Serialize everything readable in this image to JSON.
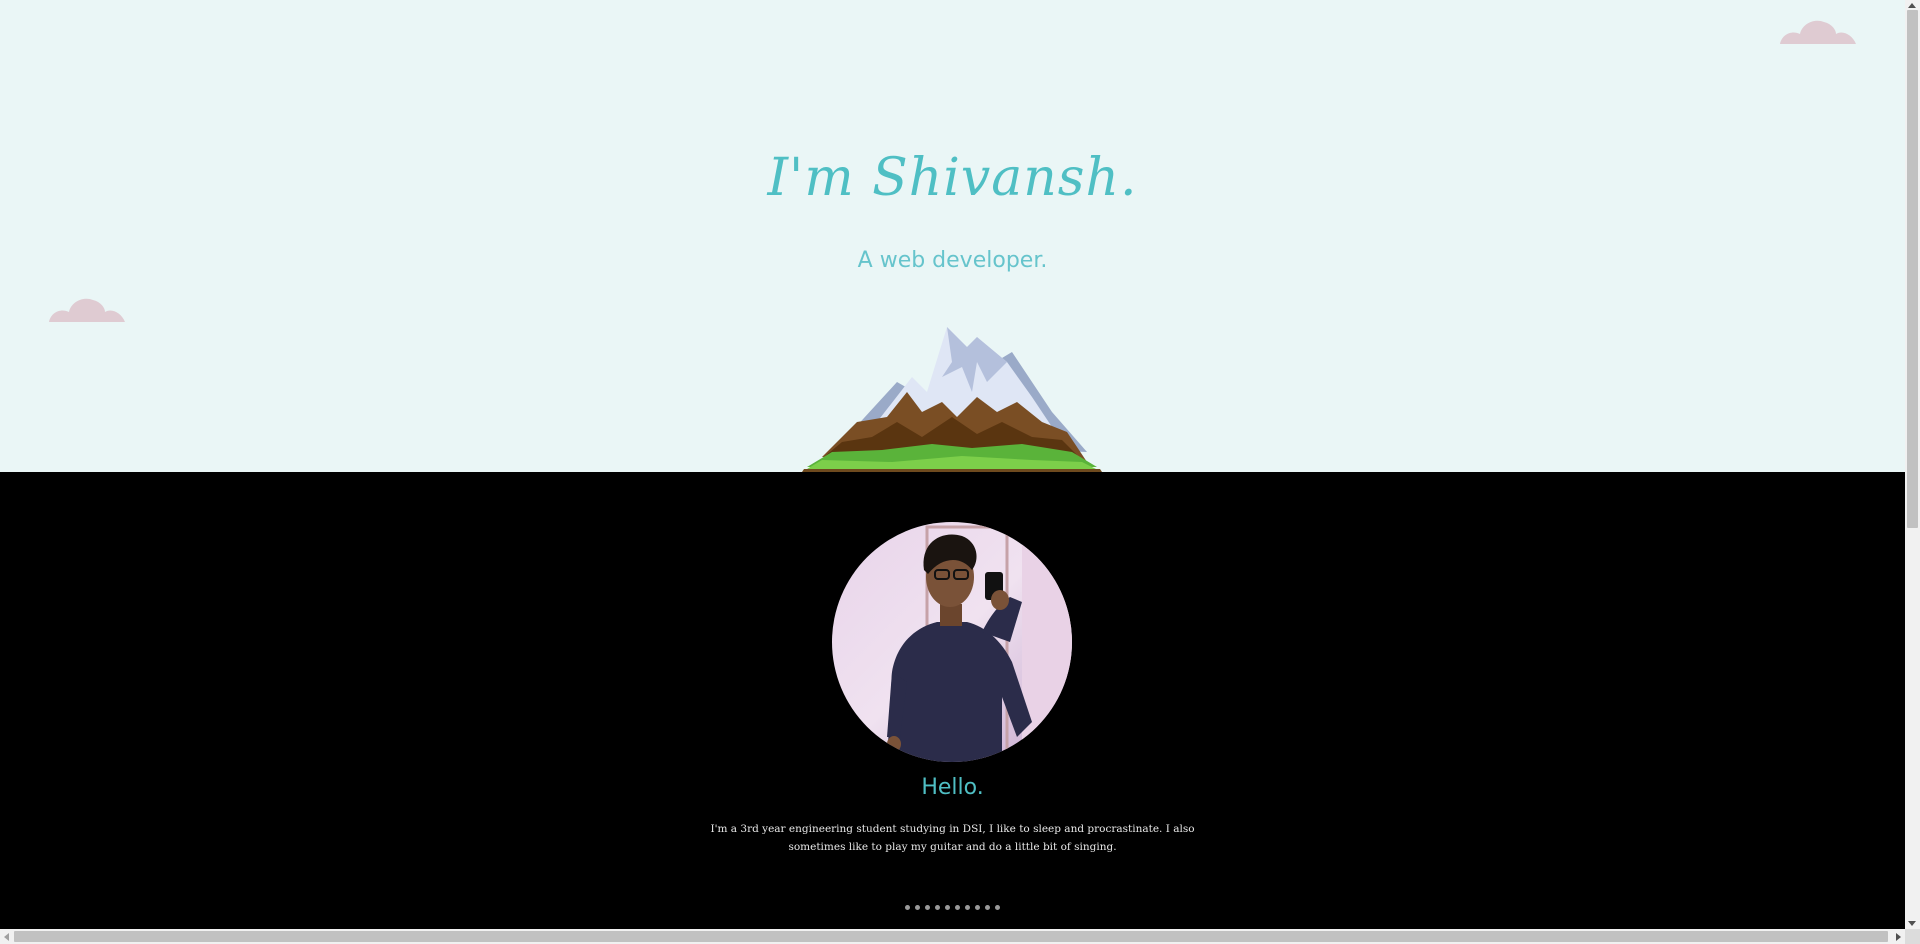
{
  "hero": {
    "title": "I'm Shivansh.",
    "subtitle": "A web developer.",
    "background_color": "#eaf6f6",
    "accent_color": "#4fbfc4",
    "cloud_color": "#dfcbd2"
  },
  "about": {
    "heading": "Hello.",
    "bio": "I'm a 3rd year engineering student studying in DSI, I like to sleep and procrastinate. I also sometimes like to play my guitar and do a little bit of singing.",
    "background_color": "#000000"
  },
  "icons": {
    "cloud": "cloud-icon",
    "mountain": "mountain-illustration",
    "avatar": "profile-photo"
  }
}
